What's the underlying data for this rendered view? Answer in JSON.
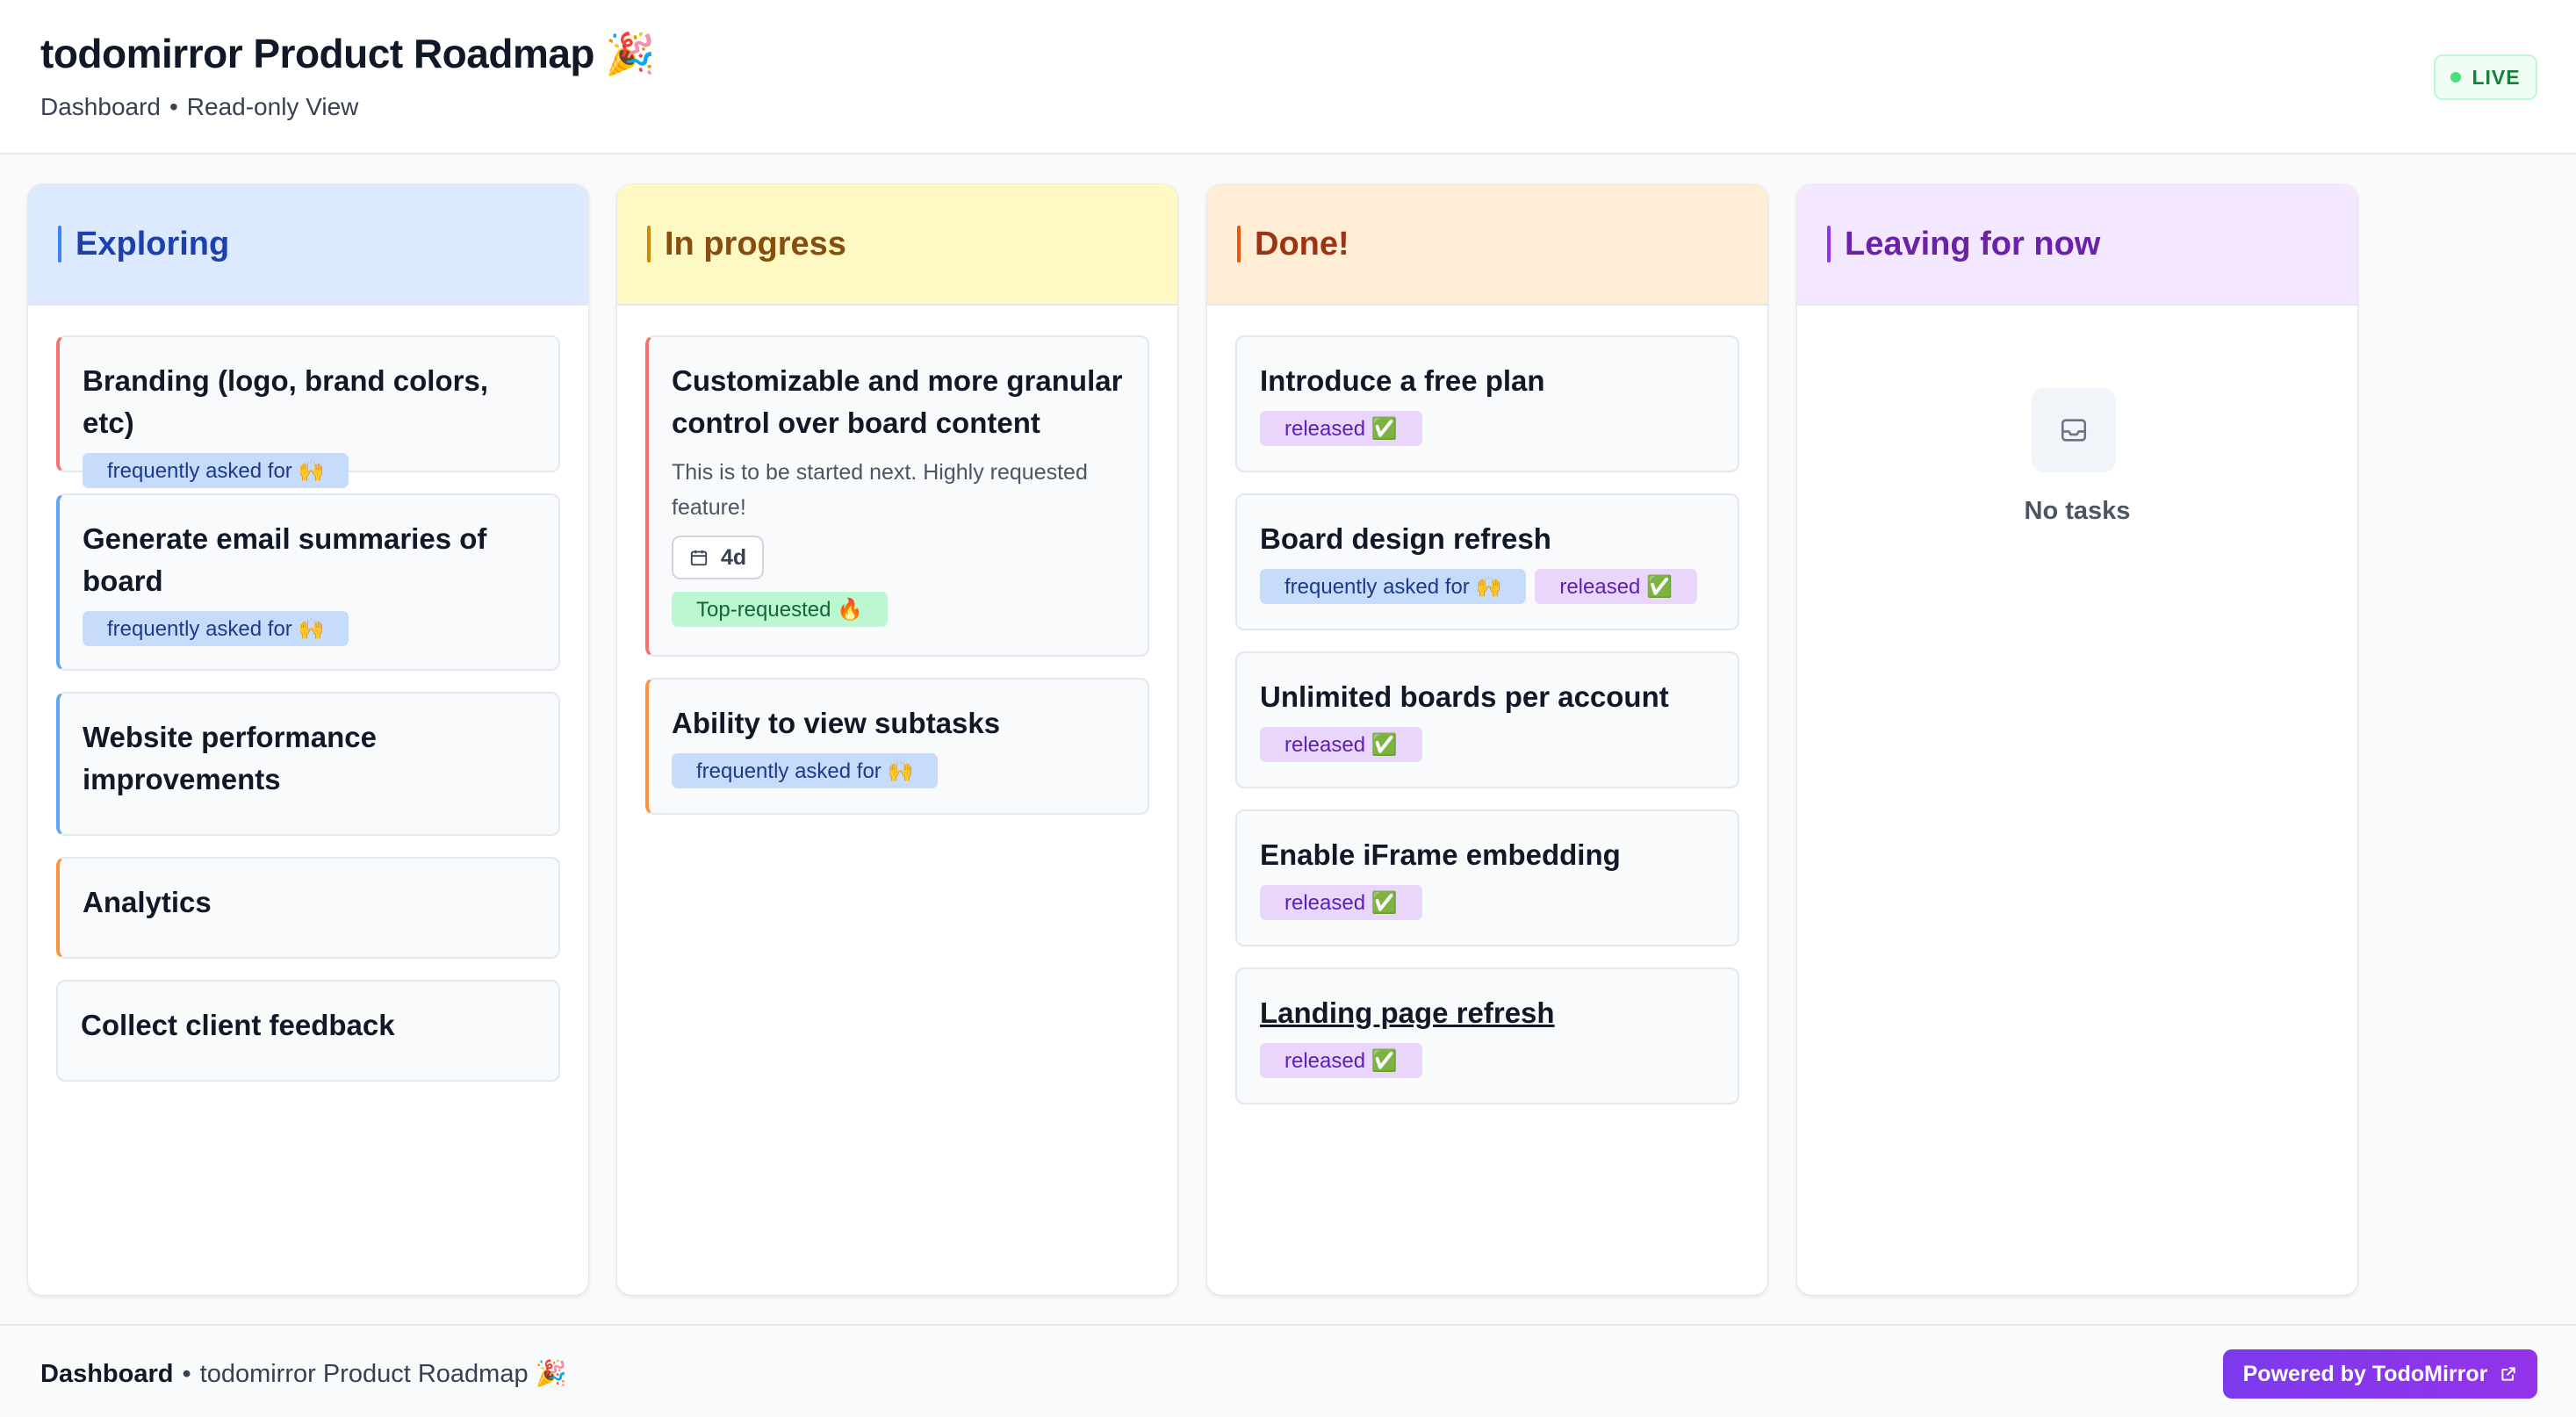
{
  "header": {
    "title": "todomirror Product Roadmap 🎉",
    "subtitle_left": "Dashboard",
    "subtitle_separator": "•",
    "subtitle_right": "Read-only View",
    "live_label": "LIVE"
  },
  "columns": [
    {
      "title": "Exploring",
      "color": "#1e40af",
      "bg": "#dbeafe",
      "cards": [
        {
          "title": "Branding (logo, brand colors, etc)",
          "tags": [
            "frequently asked for 🙌"
          ]
        },
        {
          "title": "Generate email summaries of board",
          "tags": [
            "frequently asked for 🙌"
          ]
        },
        {
          "title": "Website performance improvements"
        },
        {
          "title": "Analytics"
        },
        {
          "title": "Collect client feedback"
        }
      ]
    },
    {
      "title": "In progress",
      "color": "#854d0e",
      "bg": "#fef9c3",
      "cards": [
        {
          "title": "Customizable and more granular control over board content",
          "description": "This is to be started next. Highly requested feature!",
          "due": "4d",
          "tags": [
            "Top-requested 🔥"
          ]
        },
        {
          "title": "Ability to view subtasks",
          "tags": [
            "frequently asked for 🙌"
          ]
        }
      ]
    },
    {
      "title": "Done!",
      "color": "#9a3412",
      "bg": "#ffedd5",
      "cards": [
        {
          "title": "Introduce a free plan",
          "tags": [
            "released ✅"
          ]
        },
        {
          "title": "Board design refresh",
          "tags": [
            "frequently asked for 🙌",
            "released ✅"
          ]
        },
        {
          "title": "Unlimited boards per account",
          "tags": [
            "released ✅"
          ]
        },
        {
          "title": "Enable iFrame embedding",
          "tags": [
            "released ✅"
          ]
        },
        {
          "title": "Landing page refresh",
          "tags": [
            "released ✅"
          ]
        }
      ]
    },
    {
      "title": "Leaving for now",
      "color": "#6b21a8",
      "bg": "#f3e8ff",
      "empty_text": "No tasks",
      "empty_icon": "inbox-icon"
    }
  ],
  "footer": {
    "dashboard_label": "Dashboard",
    "separator": "•",
    "board_name": "todomirror Product Roadmap 🎉",
    "powered_label": "Powered by TodoMirror",
    "powered_icon": "external-link-icon"
  },
  "colors": {
    "accent_red": "#f87171",
    "accent_blue": "#60a5fa",
    "accent_orange": "#fb923c",
    "accent_neutral": "#e2e8f0",
    "brand_purple": "#7c3aed",
    "live_green": "#15803d"
  }
}
